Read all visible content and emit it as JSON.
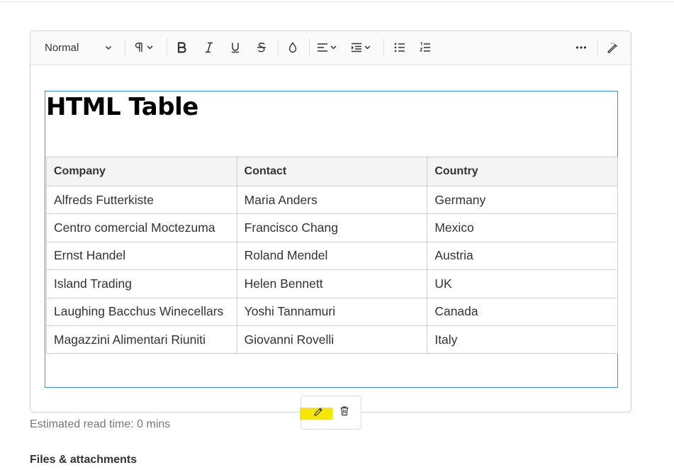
{
  "toolbar": {
    "style_select": "Normal",
    "icons": [
      "paragraph-icon",
      "bold-icon",
      "italic-icon",
      "underline-icon",
      "strikethrough-icon",
      "color-icon",
      "align-icon",
      "indent-icon",
      "bullet-list-icon",
      "numbered-list-icon",
      "more-icon",
      "clear-format-icon"
    ]
  },
  "document": {
    "heading": "HTML Table",
    "table": {
      "headers": [
        "Company",
        "Contact",
        "Country"
      ],
      "rows": [
        [
          "Alfreds Futterkiste",
          "Maria Anders",
          "Germany"
        ],
        [
          "Centro comercial Moctezuma",
          "Francisco Chang",
          "Mexico"
        ],
        [
          "Ernst Handel",
          "Roland Mendel",
          "Austria"
        ],
        [
          "Island Trading",
          "Helen Bennett",
          "UK"
        ],
        [
          "Laughing Bacchus Winecellars",
          "Yoshi Tannamuri",
          "Canada"
        ],
        [
          "Magazzini Alimentari Riuniti",
          "Giovanni Rovelli",
          "Italy"
        ]
      ]
    }
  },
  "block_tools": {
    "icons": [
      "edit-icon",
      "delete-icon"
    ],
    "highlight_color": "#f7e600"
  },
  "footer": {
    "read_time": "Estimated read time: 0 mins",
    "files_heading": "Files & attachments"
  },
  "colors": {
    "selection_border": "#3a93d6",
    "toolbar_bg": "#fafafa",
    "header_bg": "#f4f4f4"
  }
}
